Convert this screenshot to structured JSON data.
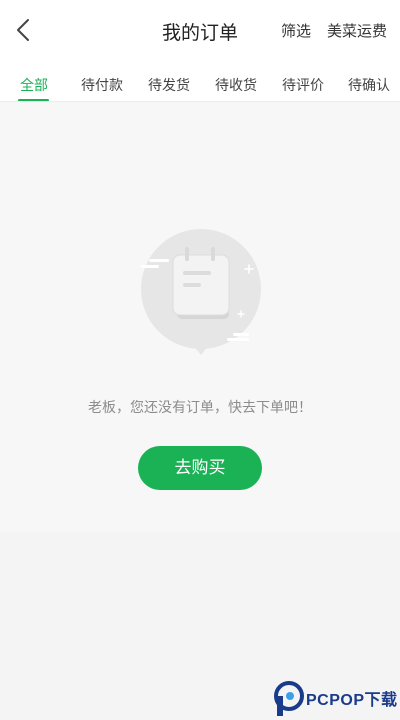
{
  "header": {
    "title": "我的订单",
    "filter_label": "筛选",
    "freight_label": "美菜运费"
  },
  "tabs": [
    {
      "label": "全部",
      "active": true
    },
    {
      "label": "待付款"
    },
    {
      "label": "待发货"
    },
    {
      "label": "待收货"
    },
    {
      "label": "待评价"
    },
    {
      "label": "待确认"
    }
  ],
  "empty_state": {
    "icon": "calendar-note-icon",
    "message": "老板，您还没有订单，快去下单吧！",
    "button_label": "去购买"
  },
  "watermark": {
    "brand": "PCPOP下载"
  },
  "colors": {
    "accent": "#1ab255",
    "background": "#f7f7f7"
  }
}
